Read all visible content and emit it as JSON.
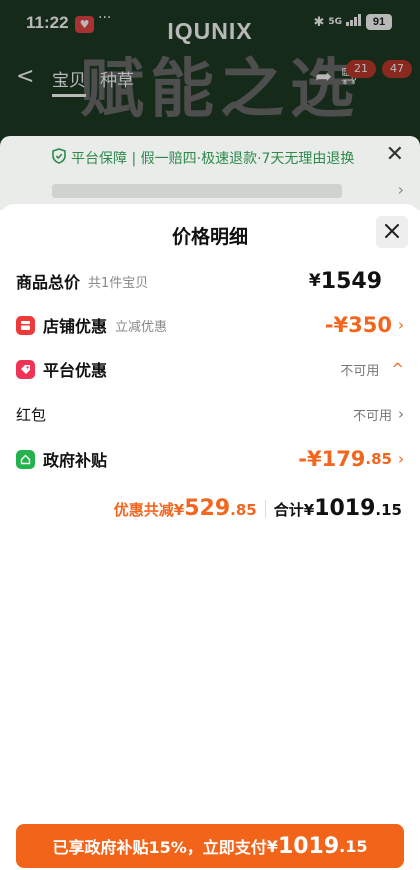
{
  "status_bar": {
    "time": "11:22",
    "dots": "···",
    "network": "5G",
    "battery": "91"
  },
  "background": {
    "brand": "IQUNIX",
    "hero_title": "赋能之选",
    "nav_back": "<",
    "nav_tabs": [
      "宝贝",
      "种草"
    ],
    "badge_1": "21",
    "badge_2": "47"
  },
  "guarantee": {
    "text": "平台保障 | 假一赔四·极速退款·7天无理由退换"
  },
  "sheet": {
    "title": "价格明细",
    "rows": {
      "total": {
        "label": "商品总价",
        "sub": "共1件宝贝",
        "currency": "¥",
        "amount": "1549"
      },
      "shop": {
        "label": "店铺优惠",
        "sub": "立减优惠",
        "amount": "-¥350"
      },
      "platform": {
        "label": "平台优惠",
        "status": "不可用"
      },
      "hongbao": {
        "label": "红包",
        "status": "不可用"
      },
      "gov": {
        "label": "政府补贴",
        "amount_main": "-¥179",
        "amount_dec": ".85"
      }
    },
    "summary": {
      "discount_label": "优惠共减¥",
      "discount_main": "529",
      "discount_dec": ".85",
      "total_label": "合计",
      "total_currency": "¥",
      "total_main": "1019",
      "total_dec": ".15"
    },
    "pay_button": {
      "text": "已享政府补贴15%，立即支付 ",
      "currency": "¥",
      "amount_main": "1019",
      "amount_dec": ".15"
    }
  },
  "colors": {
    "accent": "#f2661f",
    "guarantee_green": "#2f8a4c",
    "shop_icon": "#ef3a3a",
    "platform_icon": "#ee3355",
    "gov_icon": "#23b24b"
  }
}
